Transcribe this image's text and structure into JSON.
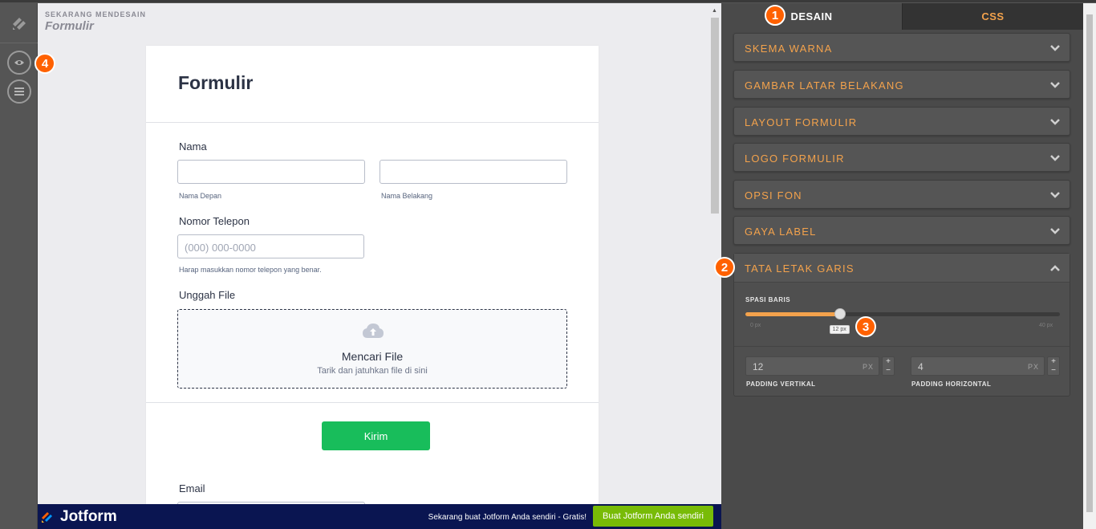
{
  "header": {
    "now_label": "SEKARANG MENDESAIN",
    "now_title": "Formulir"
  },
  "form": {
    "title": "Formulir",
    "name_label": "Nama",
    "first_sub": "Nama Depan",
    "last_sub": "Nama Belakang",
    "phone_label": "Nomor Telepon",
    "phone_placeholder": "(000) 000-0000",
    "phone_sub": "Harap masukkan nomor telepon yang benar.",
    "upload_label": "Unggah File",
    "upload_title": "Mencari File",
    "upload_sub": "Tarik dan jatuhkan file di sini",
    "submit_label": "Kirim",
    "email_label": "Email"
  },
  "bottombar": {
    "brand": "Jotform",
    "cta_text": "Sekarang buat Jotform Anda sendiri - Gratis!",
    "cta_button": "Buat Jotform Anda sendiri"
  },
  "panel": {
    "tabs": [
      "DESAIN",
      "CSS"
    ],
    "accordion": [
      "SKEMA WARNA",
      "GAMBAR LATAR BELAKANG",
      "LAYOUT FORMULIR",
      "LOGO FORMULIR",
      "OPSI FON",
      "GAYA LABEL"
    ],
    "open_section": {
      "title": "TATA LETAK GARIS",
      "slider_label": "SPASI BARIS",
      "slider_min": "0 px",
      "slider_max": "40 px",
      "slider_tooltip": "12 px",
      "slider_value": 12,
      "slider_range": [
        0,
        40
      ],
      "pad_v_value": "12",
      "pad_v_unit": "PX",
      "pad_v_label": "PADDING VERTIKAL",
      "pad_h_value": "4",
      "pad_h_unit": "PX",
      "pad_h_label": "PADDING HORIZONTAL"
    }
  },
  "badges": [
    "1",
    "2",
    "3",
    "4"
  ],
  "colors": {
    "accent": "#f3a24c",
    "badge": "#ff6100",
    "submit": "#18bd5b",
    "bottombar": "#0a1551",
    "cta": "#78bb07"
  }
}
